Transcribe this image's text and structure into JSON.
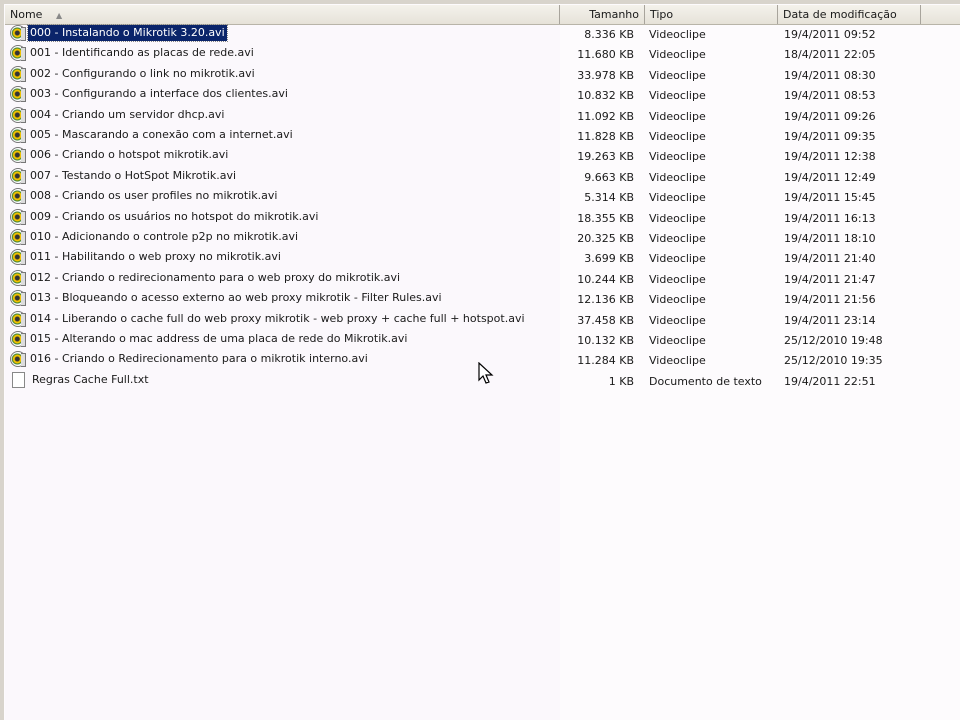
{
  "columns": {
    "name": "Nome",
    "size": "Tamanho",
    "type": "Tipo",
    "date": "Data de modificação"
  },
  "sort_indicator": "▲",
  "files": [
    {
      "name": "000 - Instalando o Mikrotik 3.20.avi",
      "size": "8.336 KB",
      "type": "Videoclipe",
      "date": "19/4/2011 09:52",
      "icon": "video-icon",
      "selected": true
    },
    {
      "name": "001 - Identificando as placas de rede.avi",
      "size": "11.680 KB",
      "type": "Videoclipe",
      "date": "18/4/2011 22:05",
      "icon": "video-icon"
    },
    {
      "name": "002 - Configurando o link no mikrotik.avi",
      "size": "33.978 KB",
      "type": "Videoclipe",
      "date": "19/4/2011 08:30",
      "icon": "video-icon"
    },
    {
      "name": "003 - Configurando a interface dos clientes.avi",
      "size": "10.832 KB",
      "type": "Videoclipe",
      "date": "19/4/2011 08:53",
      "icon": "video-icon"
    },
    {
      "name": "004 - Criando um servidor dhcp.avi",
      "size": "11.092 KB",
      "type": "Videoclipe",
      "date": "19/4/2011 09:26",
      "icon": "video-icon"
    },
    {
      "name": "005 - Mascarando a conexão com a internet.avi",
      "size": "11.828 KB",
      "type": "Videoclipe",
      "date": "19/4/2011 09:35",
      "icon": "video-icon"
    },
    {
      "name": "006 - Criando o hotspot mikrotik.avi",
      "size": "19.263 KB",
      "type": "Videoclipe",
      "date": "19/4/2011 12:38",
      "icon": "video-icon"
    },
    {
      "name": "007 - Testando o HotSpot Mikrotik.avi",
      "size": "9.663 KB",
      "type": "Videoclipe",
      "date": "19/4/2011 12:49",
      "icon": "video-icon"
    },
    {
      "name": "008 - Criando os user profiles no mikrotik.avi",
      "size": "5.314 KB",
      "type": "Videoclipe",
      "date": "19/4/2011 15:45",
      "icon": "video-icon"
    },
    {
      "name": "009 - Criando os usuários no hotspot do mikrotik.avi",
      "size": "18.355 KB",
      "type": "Videoclipe",
      "date": "19/4/2011 16:13",
      "icon": "video-icon"
    },
    {
      "name": "010 - Adicionando o controle p2p no mikrotik.avi",
      "size": "20.325 KB",
      "type": "Videoclipe",
      "date": "19/4/2011 18:10",
      "icon": "video-icon"
    },
    {
      "name": "011 - Habilitando o web proxy no mikrotik.avi",
      "size": "3.699 KB",
      "type": "Videoclipe",
      "date": "19/4/2011 21:40",
      "icon": "video-icon"
    },
    {
      "name": "012 - Criando o redirecionamento para o web proxy do mikrotik.avi",
      "size": "10.244 KB",
      "type": "Videoclipe",
      "date": "19/4/2011 21:47",
      "icon": "video-icon"
    },
    {
      "name": "013 - Bloqueando o acesso externo ao web proxy mikrotik - Filter Rules.avi",
      "size": "12.136 KB",
      "type": "Videoclipe",
      "date": "19/4/2011 21:56",
      "icon": "video-icon"
    },
    {
      "name": "014 - Liberando o cache full do web proxy mikrotik - web proxy + cache full + hotspot.avi",
      "size": "37.458 KB",
      "type": "Videoclipe",
      "date": "19/4/2011 23:14",
      "icon": "video-icon"
    },
    {
      "name": "015 - Alterando o mac address de uma placa de rede do Mikrotik.avi",
      "size": "10.132 KB",
      "type": "Videoclipe",
      "date": "25/12/2010 19:48",
      "icon": "video-icon"
    },
    {
      "name": "016 - Criando o Redirecionamento para o mikrotik interno.avi",
      "size": "11.284 KB",
      "type": "Videoclipe",
      "date": "25/12/2010 19:35",
      "icon": "video-icon"
    },
    {
      "name": "Regras Cache Full.txt",
      "size": "1 KB",
      "type": "Documento de texto",
      "date": "19/4/2011 22:51",
      "icon": "text-file-icon"
    }
  ]
}
